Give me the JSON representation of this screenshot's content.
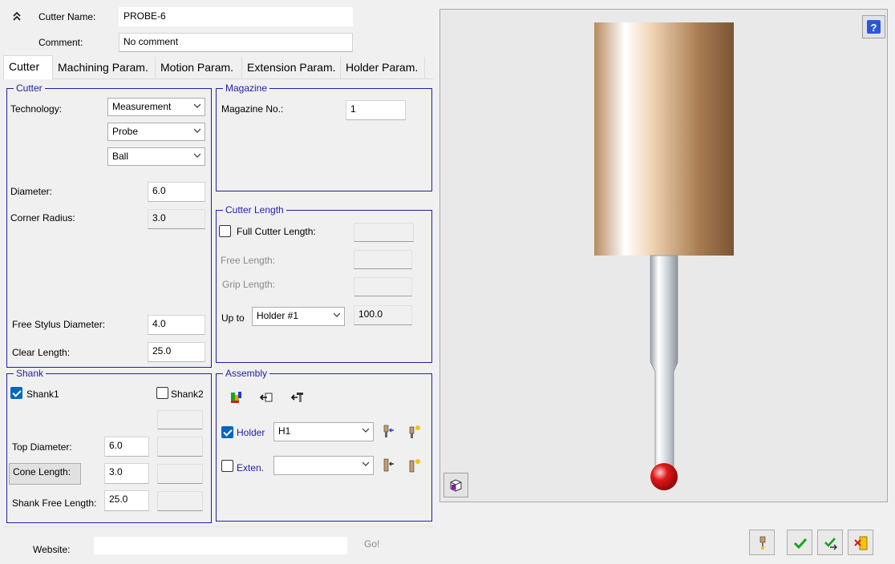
{
  "header": {
    "cutter_name_label": "Cutter Name:",
    "cutter_name_value": "PROBE-6",
    "comment_label": "Comment:",
    "comment_value": "No comment"
  },
  "tabs": [
    {
      "label": "Cutter",
      "active": true
    },
    {
      "label": "Machining Param."
    },
    {
      "label": "Motion Param."
    },
    {
      "label": "Extension Param."
    },
    {
      "label": "Holder Param."
    }
  ],
  "cutter": {
    "title": "Cutter",
    "technology_label": "Technology:",
    "technology_value": "Measurement",
    "type_value": "Probe",
    "shape_value": "Ball",
    "diameter_label": "Diameter:",
    "diameter_value": "6.0",
    "corner_radius_label": "Corner Radius:",
    "corner_radius_value": "3.0",
    "free_stylus_label": "Free Stylus Diameter:",
    "free_stylus_value": "4.0",
    "clear_length_label": "Clear Length:",
    "clear_length_value": "25.0"
  },
  "magazine": {
    "title": "Magazine",
    "number_label": "Magazine No.:",
    "number_value": "1"
  },
  "cutter_length": {
    "title": "Cutter Length",
    "full_label": "Full Cutter Length:",
    "free_label": "Free Length:",
    "grip_label": "Grip Length:",
    "upto_label": "Up to",
    "upto_value": "Holder #1",
    "upto_length": "100.0"
  },
  "shank": {
    "title": "Shank",
    "shank1_label": "Shank1",
    "shank2_label": "Shank2",
    "top_diameter_label": "Top Diameter:",
    "top_diameter_value": "6.0",
    "cone_length_label": "Cone Length:",
    "cone_length_value": "3.0",
    "free_length_label": "Shank Free Length:",
    "free_length_value": "25.0"
  },
  "assembly": {
    "title": "Assembly",
    "holder_label": "Holder",
    "holder_value": "H1",
    "exten_label": "Exten.",
    "exten_value": ""
  },
  "footer": {
    "website_label": "Website:",
    "website_value": "",
    "go_label": "Go!"
  },
  "colors": {
    "group_border": "#1f1fa8",
    "checkbox_on": "#0067c0",
    "ok_green": "#1aa31a",
    "probe_ball": "#e01818"
  }
}
